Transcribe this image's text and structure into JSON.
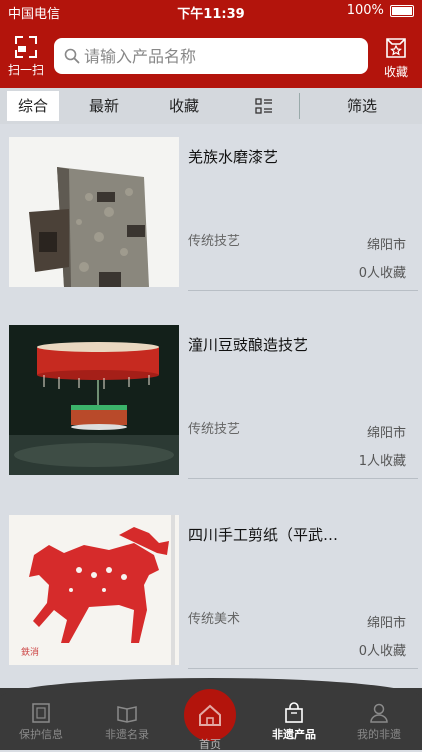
{
  "status_bar": {
    "carrier": "中国电信",
    "time": "下午11:39",
    "battery": "100%"
  },
  "header": {
    "scan_label": "扫一扫",
    "search_placeholder": "请输入产品名称",
    "favorite_label": "收藏"
  },
  "filter_bar": {
    "tabs": [
      {
        "label": "综合"
      },
      {
        "label": "最新"
      },
      {
        "label": "收藏"
      }
    ],
    "filter_label": "筛选"
  },
  "products": [
    {
      "title": "羌族水磨漆艺",
      "category": "传统技艺",
      "city": "绵阳市",
      "favorites": "0人收藏"
    },
    {
      "title": "潼川豆豉酿造技艺",
      "category": "传统技艺",
      "city": "绵阳市",
      "favorites": "1人收藏"
    },
    {
      "title": "四川手工剪纸（平武…",
      "category": "传统美术",
      "city": "绵阳市",
      "favorites": "0人收藏"
    }
  ],
  "tabbar": {
    "items": [
      {
        "label": "保护信息"
      },
      {
        "label": "非遗名录"
      },
      {
        "label": "首页"
      },
      {
        "label": "非遗产品"
      },
      {
        "label": "我的非遗"
      }
    ]
  },
  "colors": {
    "brand_red": "#b3140c",
    "tabbar_bg": "#3a3a3a"
  }
}
